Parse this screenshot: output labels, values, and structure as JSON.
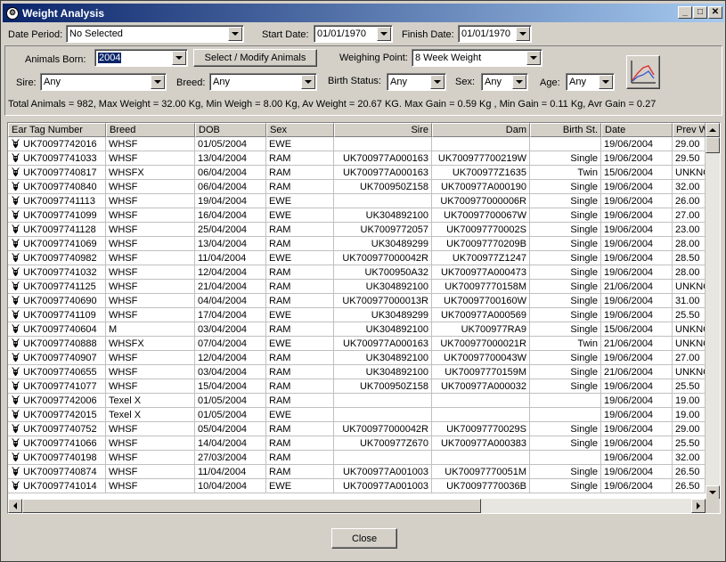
{
  "window": {
    "title": "Weight Analysis"
  },
  "filters": {
    "date_period_label": "Date Period:",
    "date_period_value": "No Selected",
    "start_date_label": "Start Date:",
    "start_date_value": "01/01/1970",
    "finish_date_label": "Finish Date:",
    "finish_date_value": "01/01/1970",
    "animals_born_label": "Animals Born:",
    "animals_born_value": "2004",
    "select_animals_button": "Select / Modify Animals",
    "weighing_point_label": "Weighing Point:",
    "weighing_point_value": "8 Week Weight",
    "sire_label": "Sire:",
    "sire_value": "Any",
    "breed_label": "Breed:",
    "breed_value": "Any",
    "birth_status_label": "Birth Status:",
    "birth_status_value": "Any",
    "sex_label": "Sex:",
    "sex_value": "Any",
    "age_label": "Age:",
    "age_value": "Any"
  },
  "summary": "Total Animals = 982, Max Weight = 32.00 Kg, Min Weigh = 8.00 Kg, Av Weight = 20.67 KG. Max Gain = 0.59 Kg , Min Gain = 0.11 Kg, Avr Gain = 0.27",
  "table": {
    "columns": [
      "Ear Tag Number",
      "Breed",
      "DOB",
      "Sex",
      "Sire",
      "Dam",
      "Birth St.",
      "Date",
      "Prev W"
    ],
    "rows": [
      [
        "UK70097742016",
        "WHSF",
        "01/05/2004",
        "EWE",
        "",
        "",
        "",
        "19/06/2004",
        "29.00"
      ],
      [
        "UK70097741033",
        "WHSF",
        "13/04/2004",
        "RAM",
        "UK700977A000163",
        "UK700977700219W",
        "Single",
        "19/06/2004",
        "29.50"
      ],
      [
        "UK70097740817",
        "WHSFX",
        "06/04/2004",
        "RAM",
        "UK700977A000163",
        "UK700977Z1635",
        "Twin",
        "15/06/2004",
        "UNKNC"
      ],
      [
        "UK70097740840",
        "WHSF",
        "06/04/2004",
        "RAM",
        "UK700950Z158",
        "UK700977A000190",
        "Single",
        "19/06/2004",
        "32.00"
      ],
      [
        "UK70097741113",
        "WHSF",
        "19/04/2004",
        "EWE",
        "",
        "UK700977000006R",
        "Single",
        "19/06/2004",
        "26.00"
      ],
      [
        "UK70097741099",
        "WHSF",
        "16/04/2004",
        "EWE",
        "UK304892100",
        "UK70097700067W",
        "Single",
        "19/06/2004",
        "27.00"
      ],
      [
        "UK70097741128",
        "WHSF",
        "25/04/2004",
        "RAM",
        "UK7009772057",
        "UK70097770002S",
        "Single",
        "19/06/2004",
        "23.00"
      ],
      [
        "UK70097741069",
        "WHSF",
        "13/04/2004",
        "RAM",
        "UK30489299",
        "UK70097770209B",
        "Single",
        "19/06/2004",
        "28.00"
      ],
      [
        "UK70097740982",
        "WHSF",
        "11/04/2004",
        "EWE",
        "UK700977000042R",
        "UK700977Z1247",
        "Single",
        "19/06/2004",
        "28.50"
      ],
      [
        "UK70097741032",
        "WHSF",
        "12/04/2004",
        "RAM",
        "UK700950A32",
        "UK700977A000473",
        "Single",
        "19/06/2004",
        "28.00"
      ],
      [
        "UK70097741125",
        "WHSF",
        "21/04/2004",
        "RAM",
        "UK304892100",
        "UK70097770158M",
        "Single",
        "21/06/2004",
        "UNKNC"
      ],
      [
        "UK70097740690",
        "WHSF",
        "04/04/2004",
        "RAM",
        "UK700977000013R",
        "UK70097700160W",
        "Single",
        "19/06/2004",
        "31.00"
      ],
      [
        "UK70097741109",
        "WHSF",
        "17/04/2004",
        "EWE",
        "UK30489299",
        "UK700977A000569",
        "Single",
        "19/06/2004",
        "25.50"
      ],
      [
        "UK70097740604",
        "M",
        "03/04/2004",
        "RAM",
        "UK304892100",
        "UK700977RA9",
        "Single",
        "15/06/2004",
        "UNKNC"
      ],
      [
        "UK70097740888",
        "WHSFX",
        "07/04/2004",
        "EWE",
        "UK700977A000163",
        "UK700977000021R",
        "Twin",
        "21/06/2004",
        "UNKNC"
      ],
      [
        "UK70097740907",
        "WHSF",
        "12/04/2004",
        "RAM",
        "UK304892100",
        "UK70097700043W",
        "Single",
        "19/06/2004",
        "27.00"
      ],
      [
        "UK70097740655",
        "WHSF",
        "03/04/2004",
        "RAM",
        "UK304892100",
        "UK70097770159M",
        "Single",
        "21/06/2004",
        "UNKNC"
      ],
      [
        "UK70097741077",
        "WHSF",
        "15/04/2004",
        "RAM",
        "UK700950Z158",
        "UK700977A000032",
        "Single",
        "19/06/2004",
        "25.50"
      ],
      [
        "UK70097742006",
        "Texel X",
        "01/05/2004",
        "RAM",
        "",
        "",
        "",
        "19/06/2004",
        "19.00"
      ],
      [
        "UK70097742015",
        "Texel X",
        "01/05/2004",
        "EWE",
        "",
        "",
        "",
        "19/06/2004",
        "19.00"
      ],
      [
        "UK70097740752",
        "WHSF",
        "05/04/2004",
        "RAM",
        "UK700977000042R",
        "UK70097770029S",
        "Single",
        "19/06/2004",
        "29.00"
      ],
      [
        "UK70097741066",
        "WHSF",
        "14/04/2004",
        "RAM",
        "UK700977Z670",
        "UK700977A000383",
        "Single",
        "19/06/2004",
        "25.50"
      ],
      [
        "UK70097740198",
        "WHSF",
        "27/03/2004",
        "RAM",
        "",
        "",
        "",
        "19/06/2004",
        "32.00"
      ],
      [
        "UK70097740874",
        "WHSF",
        "11/04/2004",
        "RAM",
        "UK700977A001003",
        "UK70097770051M",
        "Single",
        "19/06/2004",
        "26.50"
      ],
      [
        "UK70097741014",
        "WHSF",
        "10/04/2004",
        "EWE",
        "UK700977A001003",
        "UK70097770036B",
        "Single",
        "19/06/2004",
        "26.50"
      ]
    ]
  },
  "close_button": "Close",
  "icons": {
    "app": "gear-icon",
    "row": "sheep-icon",
    "chart": "line-chart-icon"
  },
  "colors": {
    "title_bar_start": "#0a246a",
    "title_bar_end": "#a6caf0",
    "window_bg": "#d4d0c8"
  }
}
